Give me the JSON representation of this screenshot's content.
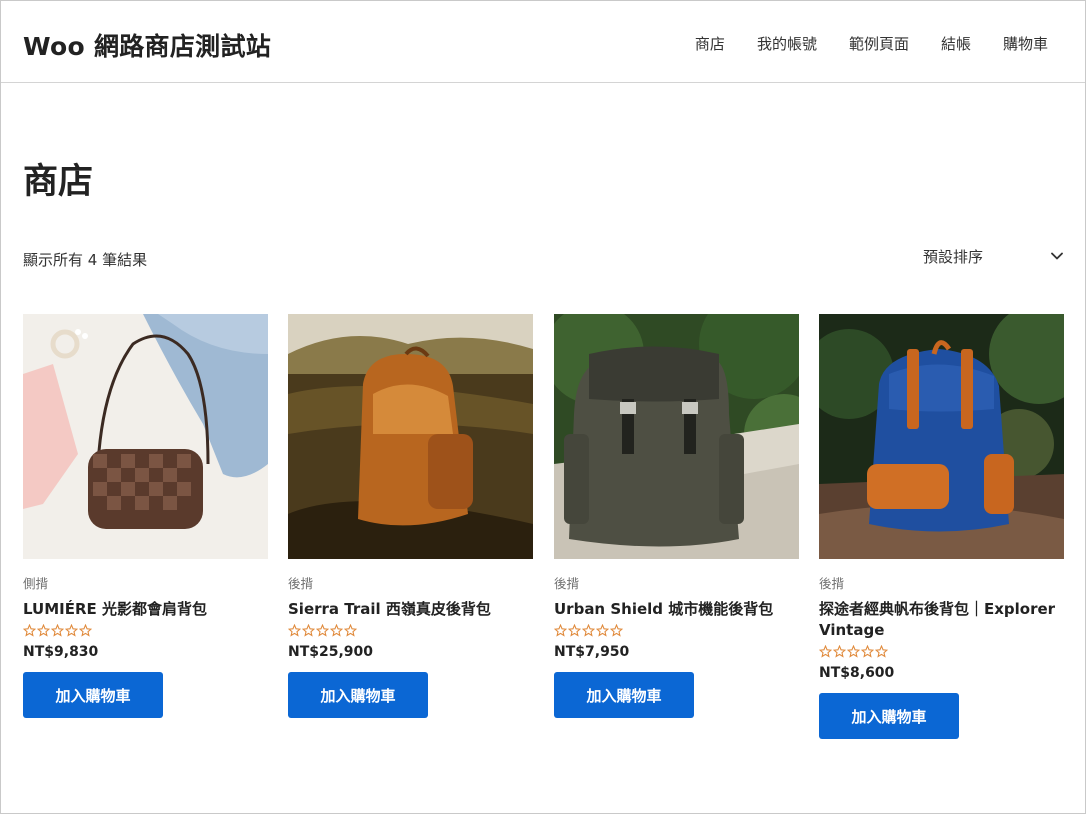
{
  "site": {
    "title": "Woo 網路商店測試站"
  },
  "nav": {
    "items": [
      "商店",
      "我的帳號",
      "範例頁面",
      "結帳",
      "購物車"
    ]
  },
  "page": {
    "title": "商店",
    "result_count": "顯示所有 4 筆結果",
    "sort_selected": "預設排序"
  },
  "products": [
    {
      "category": "側揹",
      "name": "LUMIÉRE 光影都會肩背包",
      "price": "NT$9,830",
      "button": "加入購物車",
      "rating": 0
    },
    {
      "category": "後揹",
      "name": "Sierra Trail 西嶺真皮後背包",
      "price": "NT$25,900",
      "button": "加入購物車",
      "rating": 0
    },
    {
      "category": "後揹",
      "name": "Urban Shield 城市機能後背包",
      "price": "NT$7,950",
      "button": "加入購物車",
      "rating": 0
    },
    {
      "category": "後揹",
      "name": "探途者經典帆布後背包｜Explorer Vintage",
      "price": "NT$8,600",
      "button": "加入購物車",
      "rating": 0
    }
  ],
  "colors": {
    "accent": "#0b67d4",
    "star": "#e08a3c"
  }
}
